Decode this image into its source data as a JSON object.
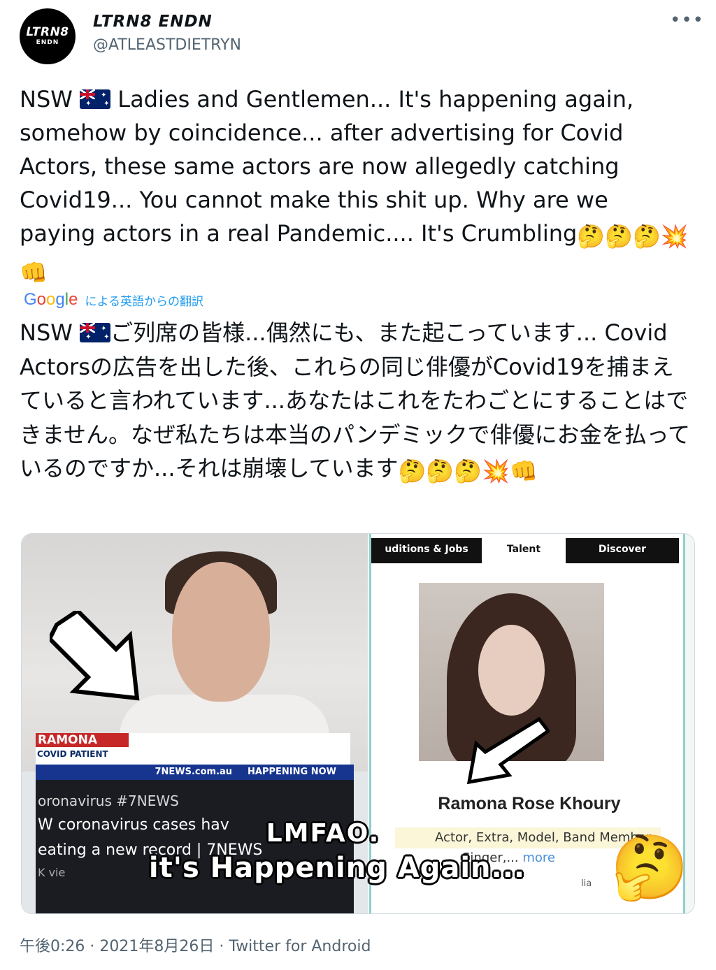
{
  "author": {
    "avatar_line1": "LTRN8",
    "avatar_line2": "ENDN",
    "display_name": "LTRN8 ENDN",
    "handle": "@ATLEASTDIETRYN"
  },
  "more_icon": "more-horizontal-icon",
  "tweet": {
    "lang_code": "NSW",
    "text_en": "Ladies and Gentlemen... It's happening again, somehow by coincidence... after advertising for Covid Actors, these same actors are now allegedly catching Covid19... You cannot make this shit up. Why are we paying actors in a real Pandemic.... It's Crumbling",
    "text_ja": "ご列席の皆様...偶然にも、また起こっています... Covid Actorsの広告を出した後、これらの同じ俳優がCovid19を捕まえていると言われています...あなたはこれをたわごとにすることはできません。なぜ私たちは本当のパンデミックで俳優にお金を払っているのですか...それは崩壊しています",
    "translation_label": "による英語からの翻訳",
    "translation_provider": "Google"
  },
  "media": {
    "left": {
      "lower_third_name": "RAMONA",
      "lower_third_sub": "COVID PATIENT",
      "news_site": "7NEWS.com.au",
      "news_status": "HAPPENING NOW",
      "yt_line1": "oronavirus #7NEWS",
      "yt_line2": "W coronavirus cases hav",
      "yt_line3": "eating a new record | 7NEWS",
      "yt_line4": "K vie"
    },
    "right": {
      "tab1": "uditions & Jobs",
      "tab2": "Talent",
      "tab3": "Discover",
      "name": "Ramona Rose Khoury",
      "roles": "Actor, Extra, Model, Band Member,",
      "singer": "Singer,...",
      "more": "more",
      "location": "lia"
    },
    "caption_line1": "LMFAO.",
    "caption_line2": "it's Happening Again..."
  },
  "meta": {
    "time": "午後0:26",
    "date": "2021年8月26日",
    "separator": "·",
    "client": "Twitter for Android"
  }
}
